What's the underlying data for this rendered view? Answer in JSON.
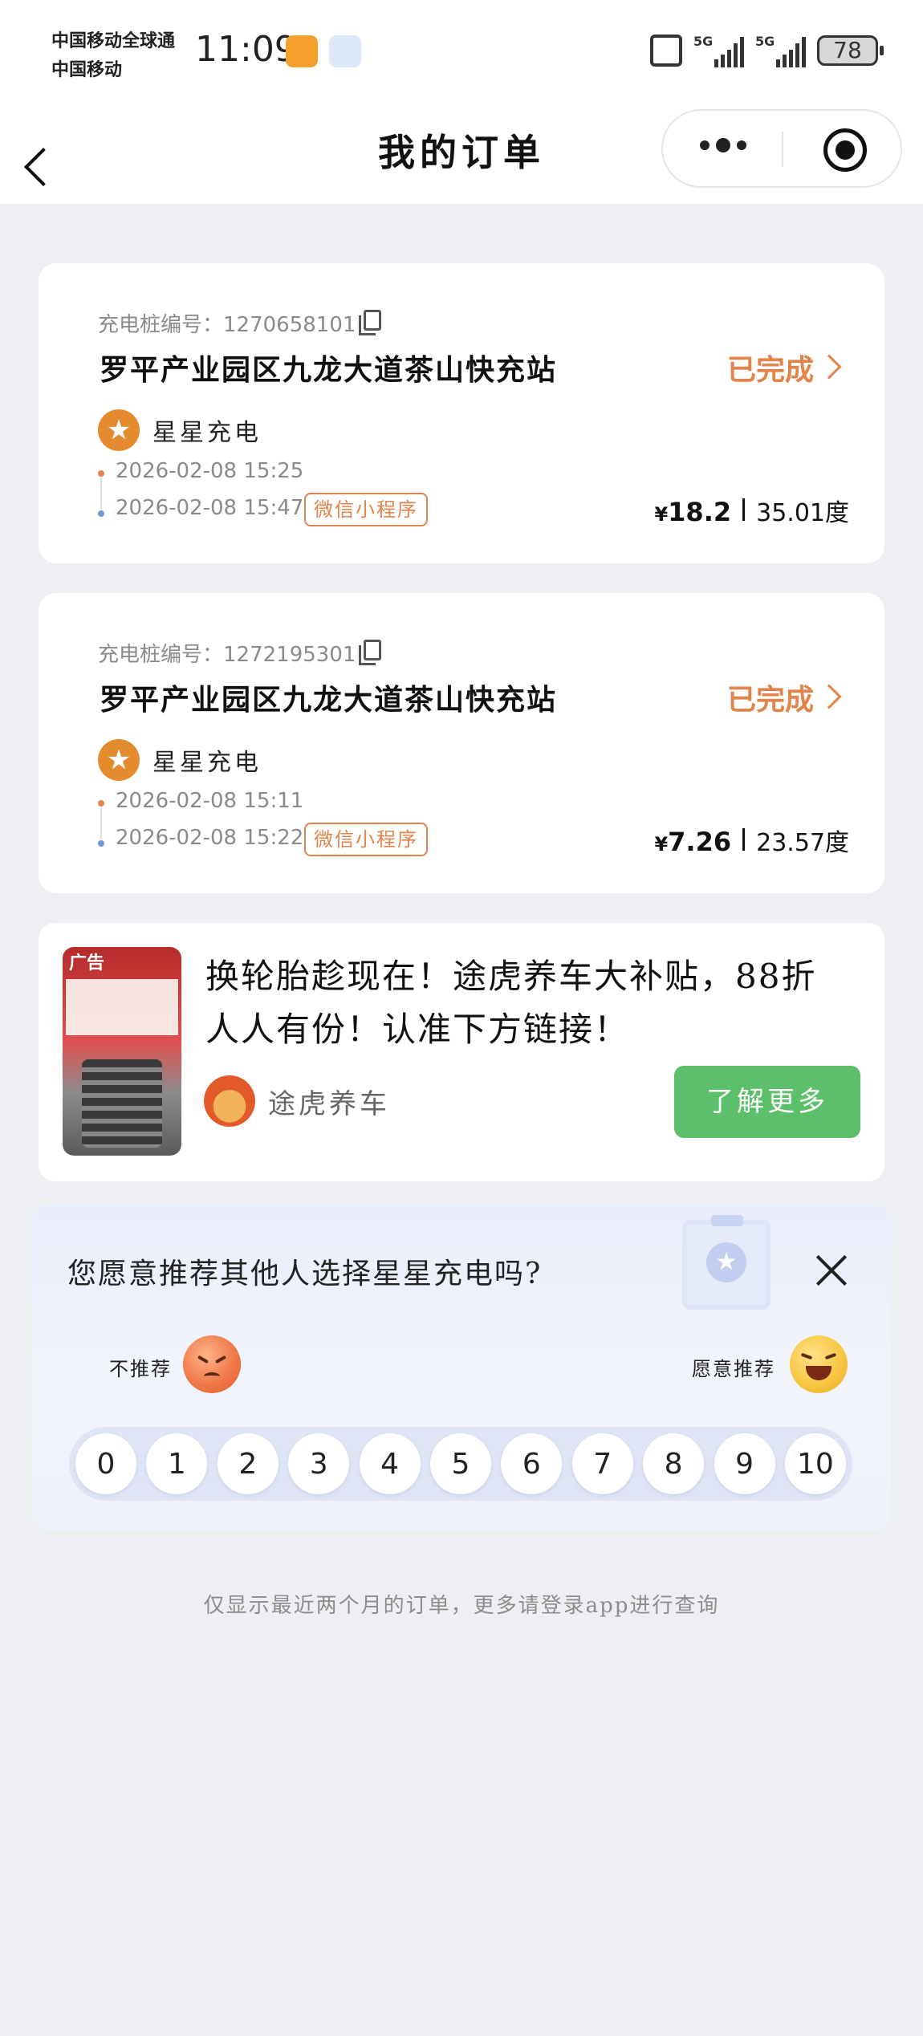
{
  "status_bar": {
    "carrier_1": "中国移动全球通",
    "carrier_2": "中国移动",
    "time": "11:09",
    "network_1": "5G",
    "network_2": "5G",
    "battery": "78"
  },
  "nav": {
    "title": "我的订单"
  },
  "orders": [
    {
      "pile_label": "充电桩编号：",
      "pile_number": "1270658101",
      "station": "罗平产业园区九龙大道茶山快充站",
      "status": "已完成",
      "operator": "星星充电",
      "start_time": "2026-02-08 15:25",
      "end_time": "2026-02-08 15:47",
      "channel": "微信小程序",
      "currency": "¥",
      "amount": "18.2",
      "energy": "35.01度"
    },
    {
      "pile_label": "充电桩编号：",
      "pile_number": "1272195301",
      "station": "罗平产业园区九龙大道茶山快充站",
      "status": "已完成",
      "operator": "星星充电",
      "start_time": "2026-02-08 15:11",
      "end_time": "2026-02-08 15:22",
      "channel": "微信小程序",
      "currency": "¥",
      "amount": "7.26",
      "energy": "23.57度"
    }
  ],
  "ad": {
    "tag": "广告",
    "text": "换轮胎趁现在！途虎养车大补贴，88折人人有份！认准下方链接！",
    "brand": "途虎养车",
    "button": "了解更多"
  },
  "survey": {
    "question": "您愿意推荐其他人选择星星充电吗?",
    "not_recommend": "不推荐",
    "recommend": "愿意推荐",
    "scores": [
      "0",
      "1",
      "2",
      "3",
      "4",
      "5",
      "6",
      "7",
      "8",
      "9",
      "10"
    ]
  },
  "footer_note": "仅显示最近两个月的订单，更多请登录app进行查询",
  "colors": {
    "accent_orange": "#e2834a",
    "button_green": "#5cc06a",
    "background": "#eeeff2"
  }
}
